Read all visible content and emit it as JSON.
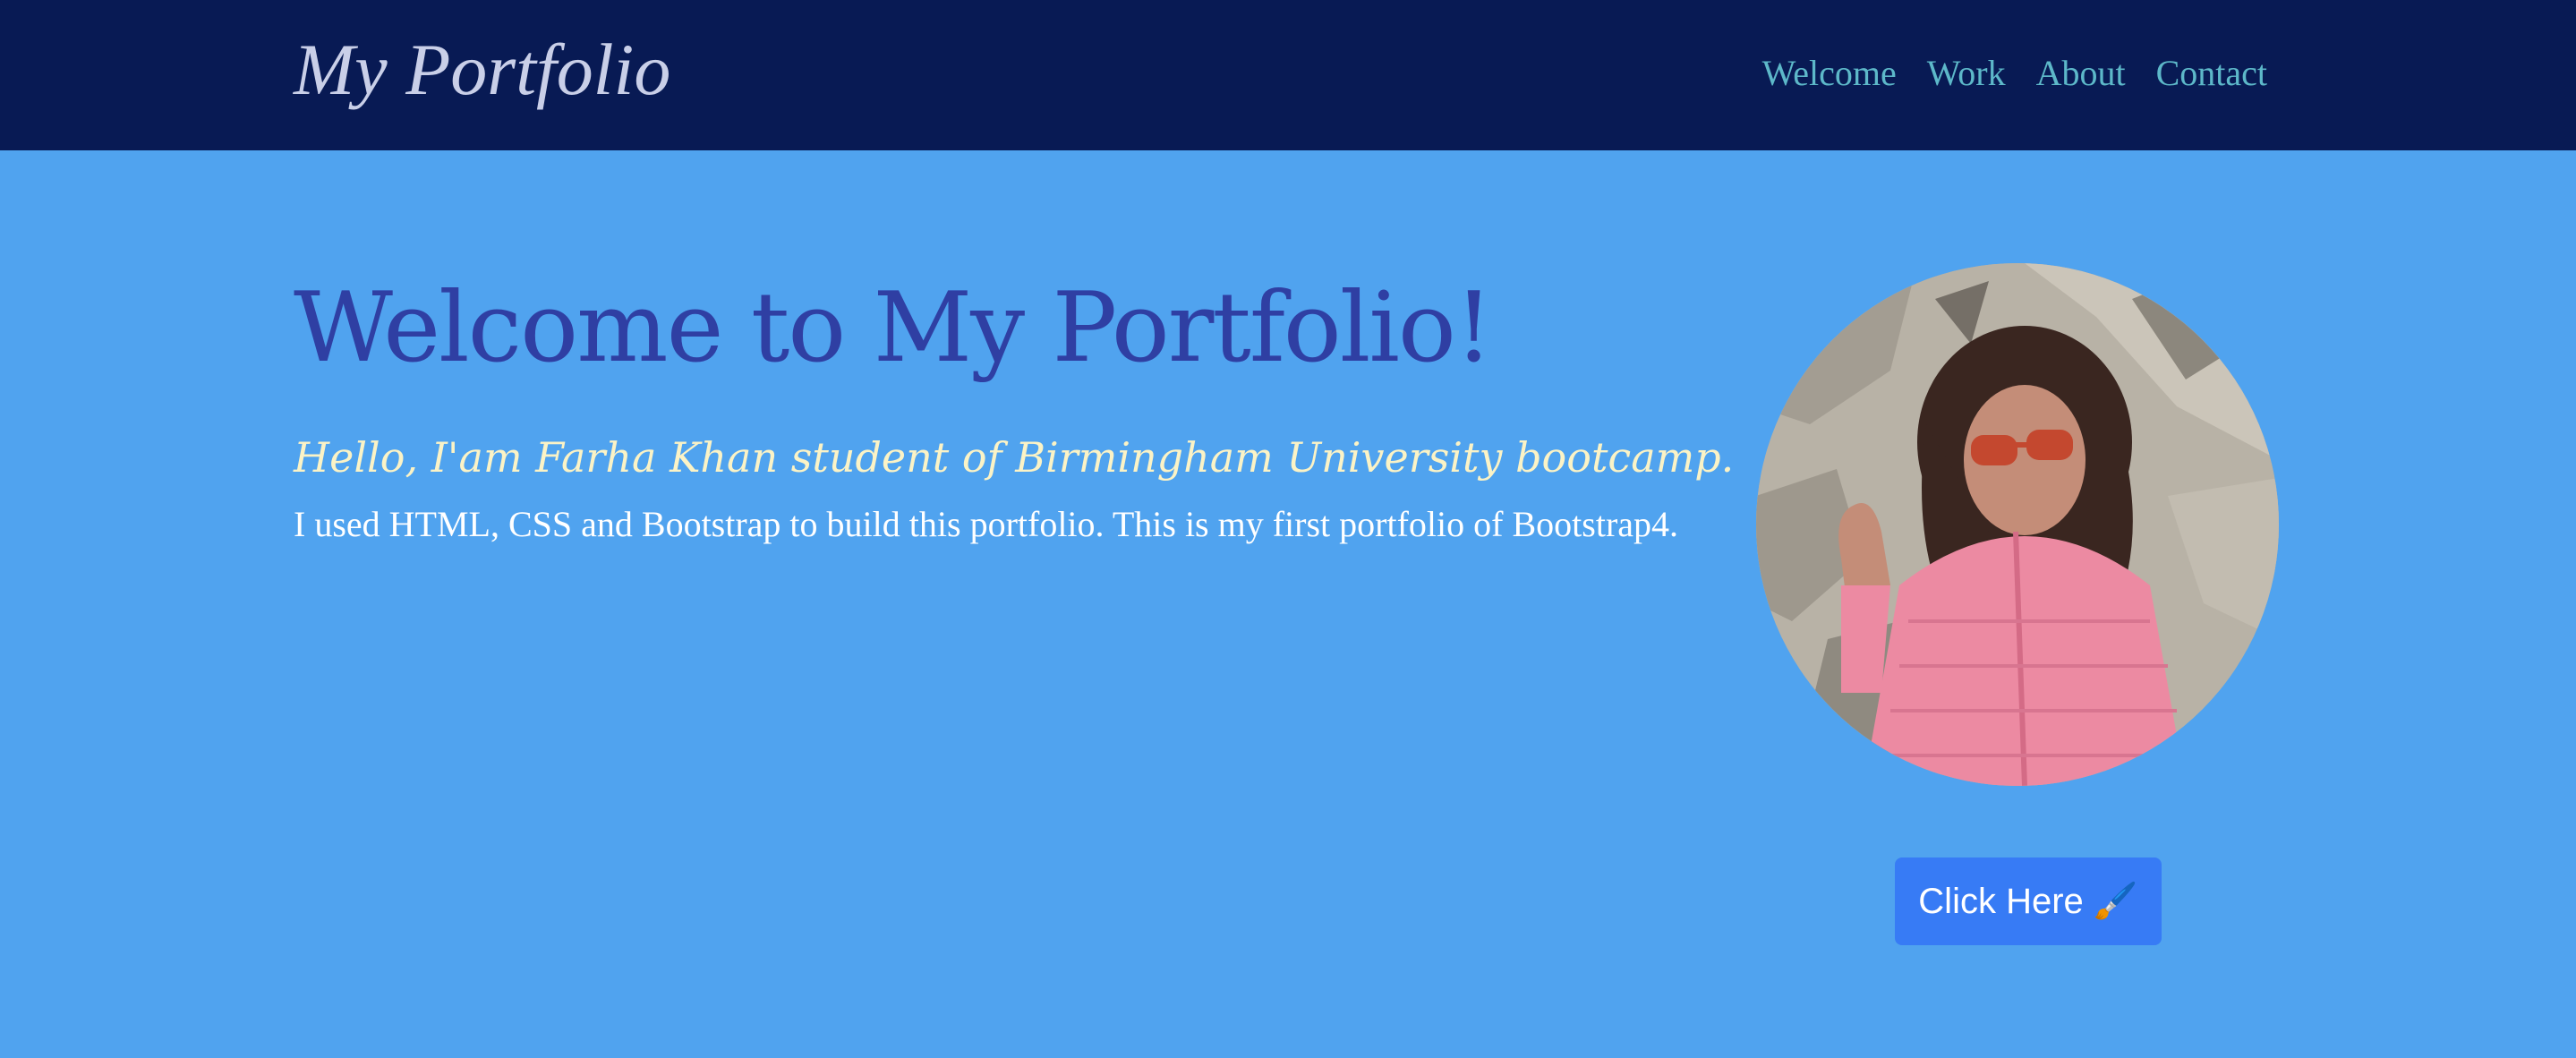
{
  "navbar": {
    "brand": "My Portfolio",
    "links": [
      "Welcome",
      "Work",
      "About",
      "Contact"
    ]
  },
  "hero": {
    "title": "Welcome to My Portfolio!",
    "subtitle": "Hello, I'am Farha Khan student of Birmingham University bootcamp.",
    "text": "I used HTML, CSS and Bootstrap to build this portfolio. This is my first portfolio of Bootstrap4.",
    "cta_label": "Click Here 🖌️"
  },
  "colors": {
    "navbar_bg": "#081a54",
    "page_bg": "#50a3ef",
    "title": "#2f3fa3",
    "subtitle": "#fbf3c6",
    "nav_link": "#5db8c9",
    "button": "#377bf5"
  },
  "icons": {
    "cta": "paintbrush-icon"
  }
}
